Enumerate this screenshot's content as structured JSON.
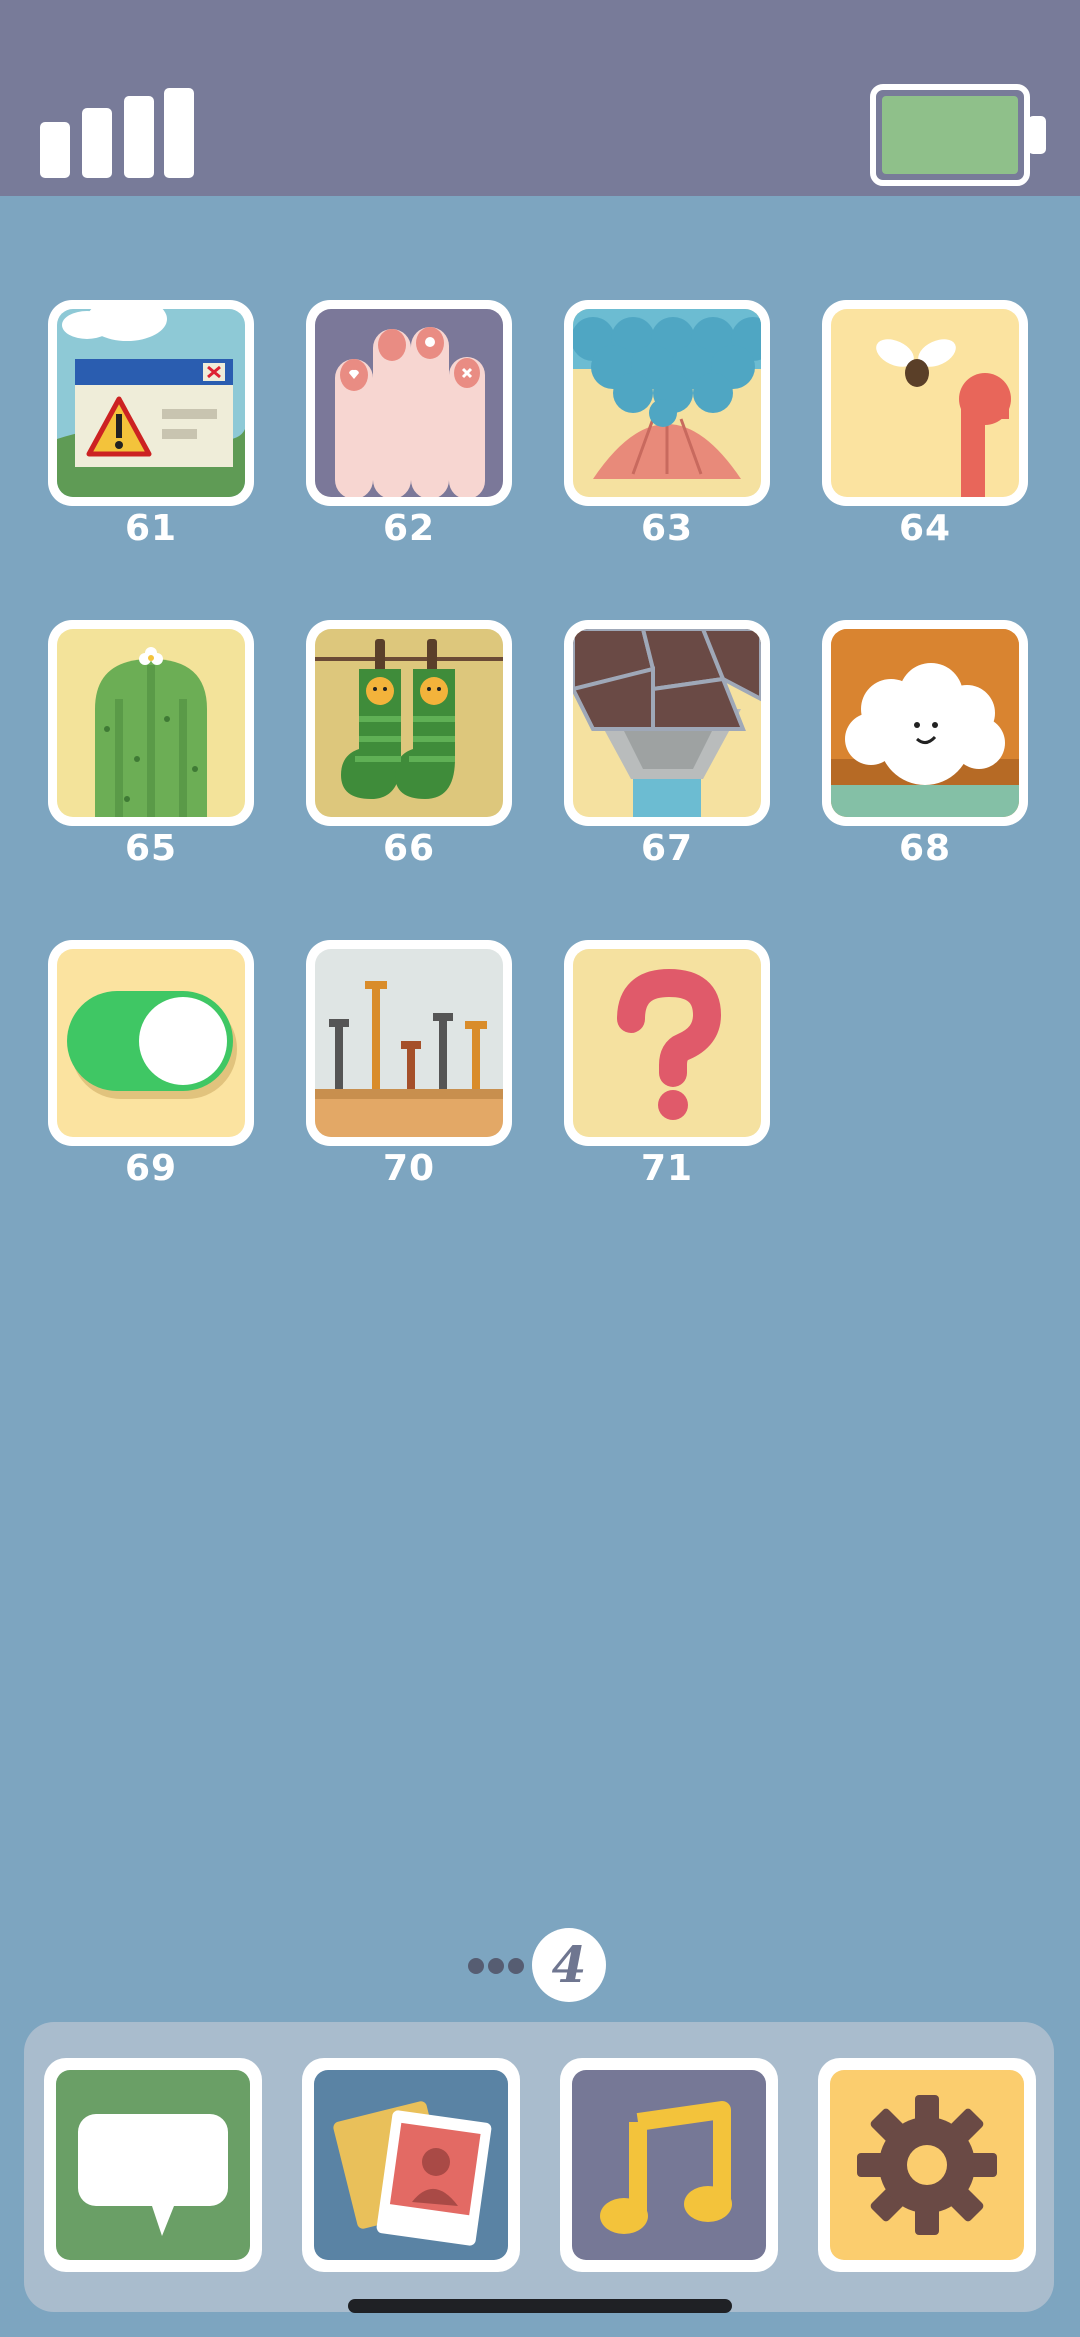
{
  "levels": [
    {
      "number": "61",
      "icon": "error-dialog-icon"
    },
    {
      "number": "62",
      "icon": "painted-fingers-icon"
    },
    {
      "number": "63",
      "icon": "mermaid-tail-icon"
    },
    {
      "number": "64",
      "icon": "fly-and-pipe-icon"
    },
    {
      "number": "65",
      "icon": "cactus-icon"
    },
    {
      "number": "66",
      "icon": "tiger-socks-icon"
    },
    {
      "number": "67",
      "icon": "chocolate-cup-icon"
    },
    {
      "number": "68",
      "icon": "fluffy-sheep-icon"
    },
    {
      "number": "69",
      "icon": "toggle-switch-icon"
    },
    {
      "number": "70",
      "icon": "screws-icon"
    },
    {
      "number": "71",
      "icon": "question-mark-icon"
    }
  ],
  "pager": {
    "current_page": "4",
    "dots_before": 3
  },
  "dock": [
    {
      "name": "messages",
      "icon": "speech-bubble-icon",
      "color": "#6a9f66"
    },
    {
      "name": "photos",
      "icon": "photos-icon",
      "color": "#5a83a4"
    },
    {
      "name": "music",
      "icon": "music-note-icon",
      "color": "#767896"
    },
    {
      "name": "settings",
      "icon": "gear-icon",
      "color": "#fbcd6e"
    }
  ],
  "status": {
    "signal": "signal-bars-icon",
    "battery": "battery-icon",
    "battery_color": "#8fc08a"
  }
}
